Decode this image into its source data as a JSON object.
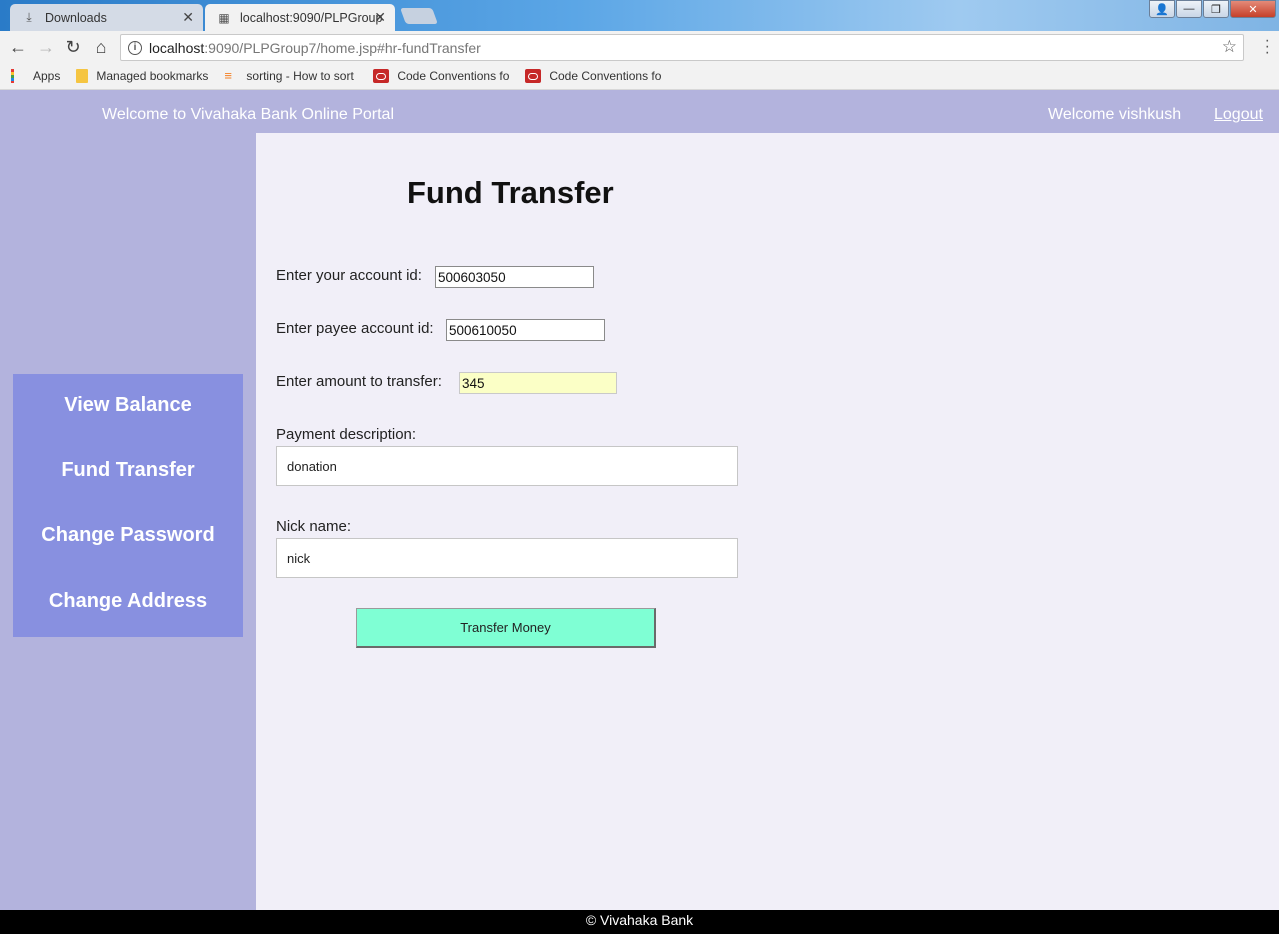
{
  "browser": {
    "tabs": [
      {
        "label": "Downloads",
        "icon": "download-icon"
      },
      {
        "label": "localhost:9090/PLPGroup",
        "icon": "page-icon"
      }
    ],
    "address": {
      "host": "localhost",
      "path": ":9090/PLPGroup7/home.jsp#hr-fundTransfer"
    },
    "bookmarks": [
      {
        "label": "Apps",
        "icon": "apps-grid-icon"
      },
      {
        "label": "Managed bookmarks",
        "icon": "folder-icon"
      },
      {
        "label": "sorting - How to sort",
        "icon": "stackoverflow-icon"
      },
      {
        "label": "Code Conventions fo",
        "icon": "oracle-icon"
      },
      {
        "label": "Code Conventions fo",
        "icon": "oracle-icon"
      }
    ]
  },
  "header": {
    "site_title": "Welcome to Vivahaka Bank Online Portal",
    "welcome_user": "Welcome vishkush",
    "logout": "Logout"
  },
  "sidebar": {
    "items": [
      {
        "label": "View Balance"
      },
      {
        "label": "Fund Transfer"
      },
      {
        "label": "Change Password"
      },
      {
        "label": "Change Address"
      }
    ]
  },
  "form": {
    "title": "Fund Transfer",
    "account_label": "Enter your account id:",
    "account_value": "500603050",
    "payee_label": "Enter payee account id:",
    "payee_value": "500610050",
    "amount_label": "Enter amount to transfer:",
    "amount_value": "345",
    "description_label": "Payment description:",
    "description_value": "donation",
    "nickname_label": "Nick name:",
    "nickname_value": "nick",
    "submit_label": "Transfer Money"
  },
  "footer": {
    "text": "© Vivahaka Bank"
  },
  "colors": {
    "header_bg": "#b3b3dd",
    "sidebar_menu_bg": "#8890e0",
    "content_bg": "#f1eff8",
    "submit_bg": "#7fffd4",
    "focused_input_bg": "#fbffc6"
  }
}
